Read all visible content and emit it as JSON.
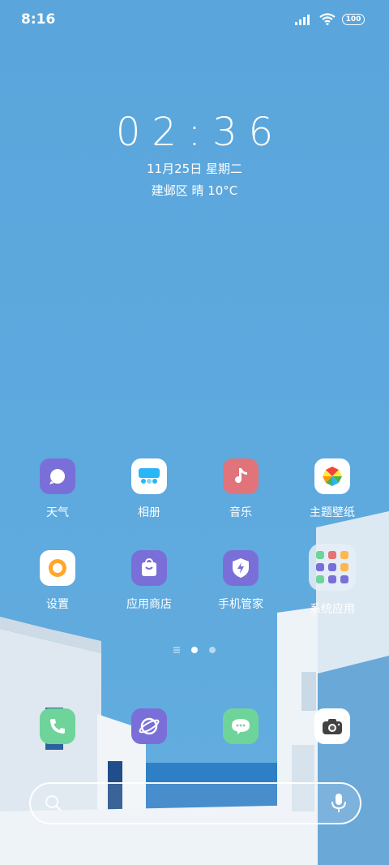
{
  "status_bar": {
    "time": "8:16",
    "battery": "100"
  },
  "clock": {
    "time": "02:36",
    "date": "11月25日 星期二",
    "weather": "建邺区 晴 10°C"
  },
  "apps_row1": [
    {
      "label": "天气",
      "icon": "weather-icon",
      "color": "#7a6fd8"
    },
    {
      "label": "相册",
      "icon": "gallery-icon",
      "color": "#ffffff"
    },
    {
      "label": "音乐",
      "icon": "music-icon",
      "color": "#e0747a"
    },
    {
      "label": "主题壁纸",
      "icon": "theme-icon",
      "color": "#ffffff"
    }
  ],
  "apps_row2": [
    {
      "label": "设置",
      "icon": "settings-icon",
      "color": "#ffffff"
    },
    {
      "label": "应用商店",
      "icon": "app-store-icon",
      "color": "#7a6fd8"
    },
    {
      "label": "手机管家",
      "icon": "security-icon",
      "color": "#7a6fd8"
    },
    {
      "label": "系统应用",
      "icon": "folder-icon",
      "color": "#e6eef6"
    }
  ],
  "dock": [
    {
      "icon": "phone-icon",
      "color": "#6fd49a"
    },
    {
      "icon": "browser-icon",
      "color": "#7a6fd8"
    },
    {
      "icon": "messages-icon",
      "color": "#6fd49a"
    },
    {
      "icon": "camera-icon",
      "color": "#ffffff"
    }
  ]
}
